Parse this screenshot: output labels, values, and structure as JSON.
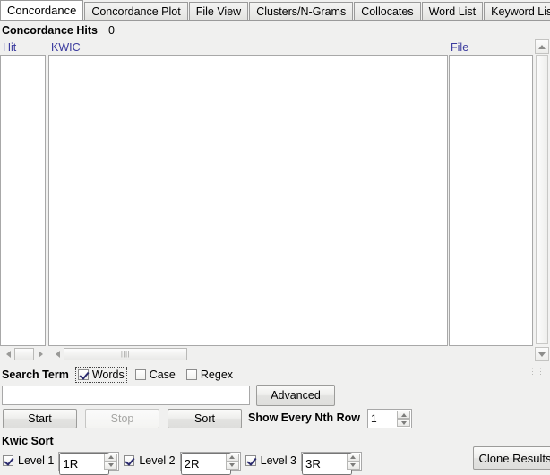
{
  "tabs": [
    {
      "label": "Concordance",
      "active": true
    },
    {
      "label": "Concordance Plot",
      "active": false
    },
    {
      "label": "File View",
      "active": false
    },
    {
      "label": "Clusters/N-Grams",
      "active": false
    },
    {
      "label": "Collocates",
      "active": false
    },
    {
      "label": "Word List",
      "active": false
    },
    {
      "label": "Keyword List",
      "active": false
    }
  ],
  "hits": {
    "label": "Concordance Hits",
    "value": "0"
  },
  "columns": {
    "hit": "Hit",
    "kwic": "KWIC",
    "file": "File"
  },
  "search": {
    "term_label": "Search Term",
    "words_label": "Words",
    "case_label": "Case",
    "regex_label": "Regex",
    "words_checked": true,
    "case_checked": false,
    "regex_checked": false,
    "input_value": "",
    "input_placeholder": "",
    "advanced_label": "Advanced"
  },
  "actions": {
    "start_label": "Start",
    "stop_label": "Stop",
    "stop_disabled": true,
    "sort_label": "Sort",
    "nth_row_label": "Show Every Nth Row",
    "nth_row_value": "1"
  },
  "kwic_sort": {
    "title": "Kwic Sort",
    "levels": [
      {
        "label": "Level 1",
        "value": "1R",
        "checked": true
      },
      {
        "label": "Level 2",
        "value": "2R",
        "checked": true
      },
      {
        "label": "Level 3",
        "value": "3R",
        "checked": true
      }
    ],
    "clone_label": "Clone Results"
  },
  "colors": {
    "column_header": "#3b3b9e",
    "panel_bg": "#f0f0ef",
    "pane_bg": "#ffffff"
  }
}
